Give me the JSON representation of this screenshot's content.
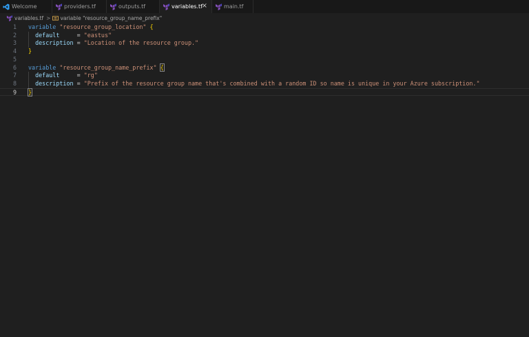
{
  "tabs": [
    {
      "label": "Welcome",
      "icon": "vscode-logo-icon",
      "active": false
    },
    {
      "label": "providers.tf",
      "icon": "terraform-icon",
      "active": false
    },
    {
      "label": "outputs.tf",
      "icon": "terraform-icon",
      "active": false
    },
    {
      "label": "variables.tf",
      "icon": "terraform-icon",
      "active": true,
      "close": "×"
    },
    {
      "label": "main.tf",
      "icon": "terraform-icon",
      "active": false
    }
  ],
  "breadcrumb": {
    "file": "variables.tf",
    "separator": ">",
    "symbol": "variable \"resource_group_name_prefix\""
  },
  "editor": {
    "lines": [
      {
        "n": "1",
        "parts": [
          {
            "t": "variable",
            "c": "kw"
          },
          {
            "t": " ",
            "c": "plain"
          },
          {
            "t": "\"resource_group_location\"",
            "c": "str"
          },
          {
            "t": " ",
            "c": "plain"
          },
          {
            "t": "{",
            "c": "brace"
          }
        ]
      },
      {
        "n": "2",
        "parts": [
          {
            "t": "  ",
            "c": "plain"
          },
          {
            "t": "default",
            "c": "prop"
          },
          {
            "t": "     = ",
            "c": "plain"
          },
          {
            "t": "\"eastus\"",
            "c": "str"
          }
        ]
      },
      {
        "n": "3",
        "parts": [
          {
            "t": "  ",
            "c": "plain"
          },
          {
            "t": "description",
            "c": "prop"
          },
          {
            "t": " = ",
            "c": "plain"
          },
          {
            "t": "\"Location of the resource group.\"",
            "c": "str"
          }
        ]
      },
      {
        "n": "4",
        "parts": [
          {
            "t": "}",
            "c": "brace"
          }
        ]
      },
      {
        "n": "5",
        "parts": []
      },
      {
        "n": "6",
        "parts": [
          {
            "t": "variable",
            "c": "kw"
          },
          {
            "t": " ",
            "c": "plain"
          },
          {
            "t": "\"resource_group_name_prefix\"",
            "c": "str"
          },
          {
            "t": " ",
            "c": "plain"
          },
          {
            "t": "{",
            "c": "brace-box"
          }
        ]
      },
      {
        "n": "7",
        "parts": [
          {
            "t": "  ",
            "c": "plain"
          },
          {
            "t": "default",
            "c": "prop"
          },
          {
            "t": "     = ",
            "c": "plain"
          },
          {
            "t": "\"rg\"",
            "c": "str"
          }
        ]
      },
      {
        "n": "8",
        "parts": [
          {
            "t": "  ",
            "c": "plain"
          },
          {
            "t": "description",
            "c": "prop"
          },
          {
            "t": " = ",
            "c": "plain"
          },
          {
            "t": "\"Prefix of the resource group name that's combined with a random ID so name is unique in your Azure subscription.\"",
            "c": "str"
          }
        ]
      },
      {
        "n": "9",
        "parts": [
          {
            "t": "}",
            "c": "brace-box"
          }
        ],
        "current": true
      }
    ]
  },
  "colors": {
    "background": "#1f1f1f",
    "tab_bar": "#181818",
    "keyword": "#569cd6",
    "string": "#ce9178",
    "property": "#9cdcfe",
    "brace": "#ffd700",
    "terraform_icon": "#844fba",
    "vscode_icon": "#2f9cf1"
  }
}
